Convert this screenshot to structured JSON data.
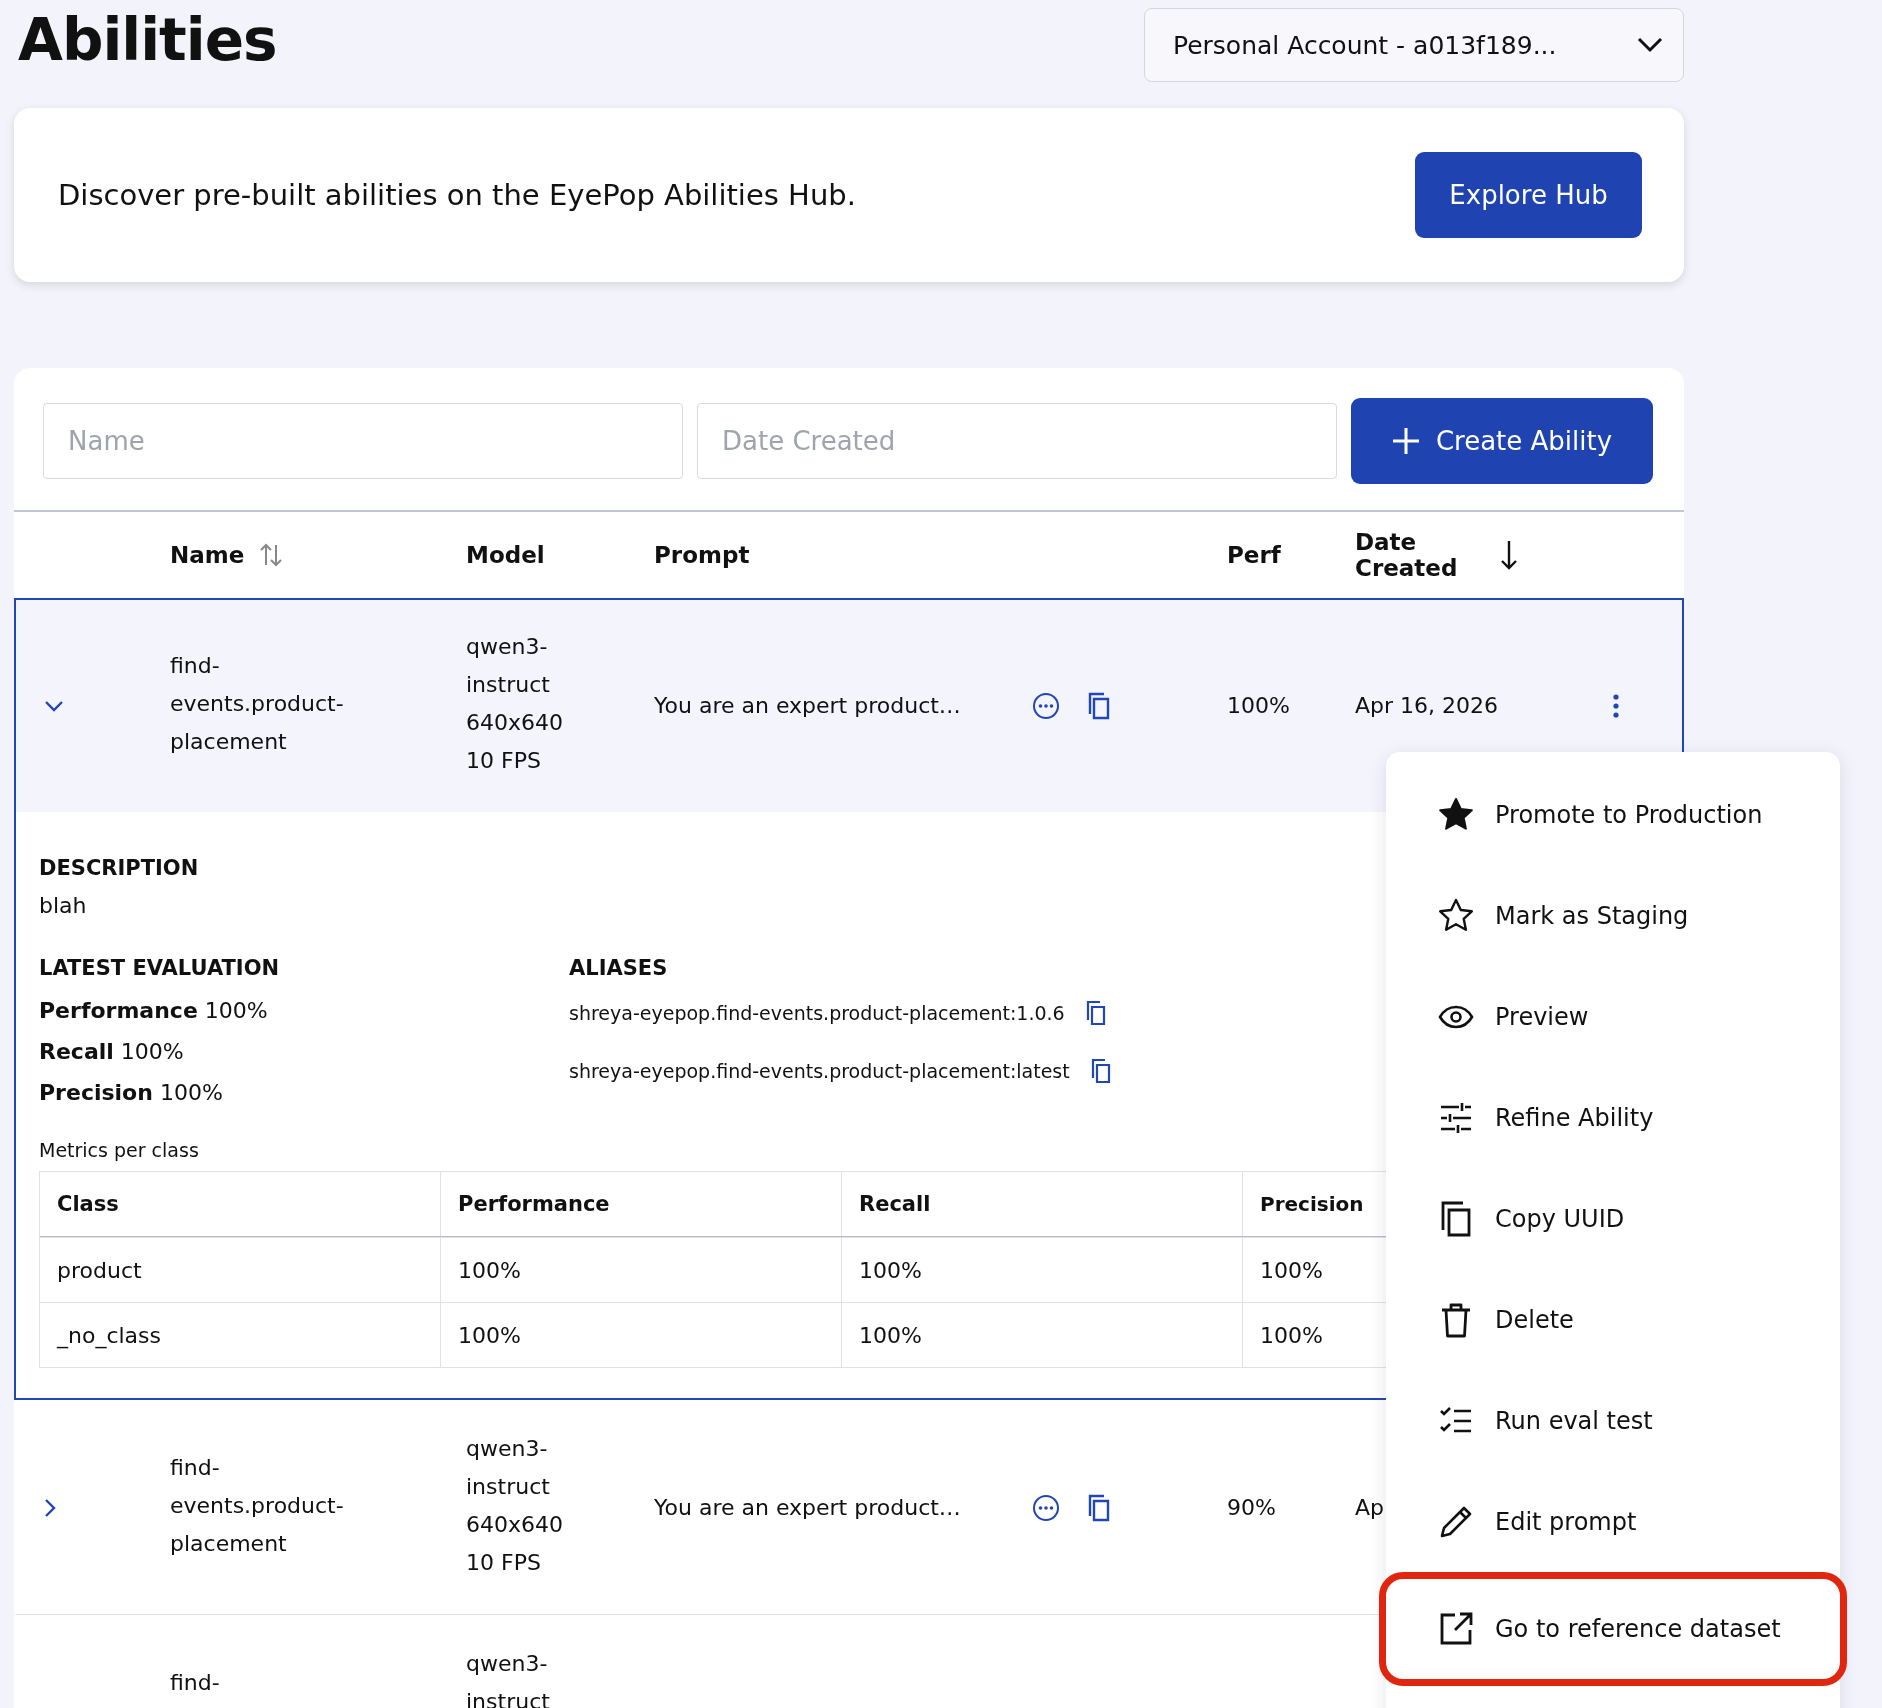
{
  "page_title": "Abilities",
  "account_select": {
    "value": "Personal Account - a013f189..."
  },
  "hub_banner": {
    "text": "Discover pre-built abilities on the EyePop Abilities Hub.",
    "button": "Explore Hub"
  },
  "filters": {
    "name": {
      "placeholder": "Name"
    },
    "date_created": {
      "placeholder": "Date Created"
    },
    "create_button": "Create Ability"
  },
  "table": {
    "columns": [
      {
        "label": "Name",
        "sortable": true,
        "sorted": false
      },
      {
        "label": "Model",
        "sortable": false,
        "sorted": false
      },
      {
        "label": "Prompt",
        "sortable": false,
        "sorted": false
      },
      {
        "label": "Perf",
        "sortable": false,
        "sorted": false
      },
      {
        "label": "Date Created",
        "sortable": true,
        "sorted": true
      }
    ],
    "rows": [
      {
        "expanded": true,
        "selected": true,
        "name": "find-events.product-placement",
        "model": "qwen3-instruct 640x640 10 FPS",
        "prompt": "You are an expert product…",
        "perf": "100%",
        "date": "Apr 16, 2026",
        "actions_button": true,
        "toggle_shown": true,
        "details": {
          "description_label": "DESCRIPTION",
          "description": "blah",
          "evaluation_label": "LATEST EVALUATION",
          "metrics": [
            {
              "label": "Performance",
              "value": "100%"
            },
            {
              "label": "Recall",
              "value": "100%"
            },
            {
              "label": "Precision",
              "value": "100%"
            }
          ],
          "aliases_label": "ALIASES",
          "aliases": [
            "shreya-eyepop.find-events.product-placement:1.0.6",
            "shreya-eyepop.find-events.product-placement:latest"
          ],
          "class_metrics": {
            "caption": "Metrics per class",
            "columns": [
              "Class",
              "Performance",
              "Recall",
              "Precision"
            ],
            "rows": [
              [
                "product",
                "100%",
                "100%",
                "100%"
              ],
              [
                "_no_class",
                "100%",
                "100%",
                "100%"
              ]
            ]
          }
        }
      },
      {
        "expanded": false,
        "selected": false,
        "name": "find-events.product-placement",
        "model": "qwen3-instruct 640x640 10 FPS",
        "prompt": "You are an expert product…",
        "perf": "90%",
        "date": "Ap",
        "actions_button": false,
        "toggle_shown": true
      },
      {
        "expanded": false,
        "selected": false,
        "name": "find-",
        "model": "qwen3-instruct",
        "actions_button": false,
        "toggle_shown": false
      }
    ]
  },
  "context_menu": {
    "items": [
      {
        "label": "Promote to Production",
        "highlighted": false
      },
      {
        "label": "Mark as Staging",
        "highlighted": false
      },
      {
        "label": "Preview",
        "highlighted": false
      },
      {
        "label": "Refine Ability",
        "highlighted": false
      },
      {
        "label": "Copy UUID",
        "highlighted": false
      },
      {
        "label": "Delete",
        "highlighted": false
      },
      {
        "label": "Run eval test",
        "highlighted": false
      },
      {
        "label": "Edit prompt",
        "highlighted": false
      },
      {
        "label": "Go to reference dataset",
        "highlighted": true
      }
    ]
  }
}
